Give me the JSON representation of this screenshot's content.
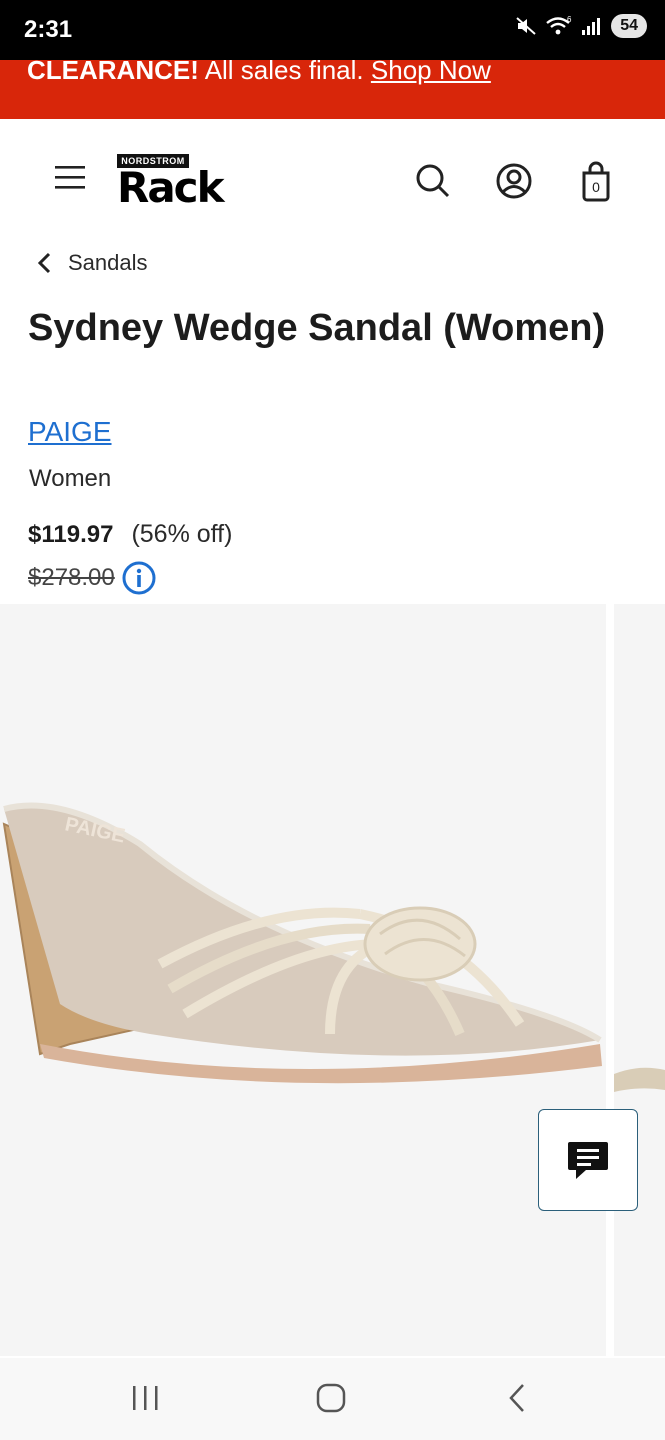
{
  "status": {
    "time": "2:31",
    "battery": "54",
    "network": "6"
  },
  "promo": {
    "strong": "CLEARANCE!",
    "text": "All sales final.",
    "link": "Shop Now",
    "bg_color": "#d8260a"
  },
  "header": {
    "logo_top": "NORDSTROM",
    "logo_main": "Rack",
    "icons": [
      "menu-icon",
      "search-icon",
      "account-icon",
      "bag-icon"
    ]
  },
  "breadcrumb": {
    "label": "Sandals"
  },
  "product": {
    "title": "Sydney Wedge Sandal (Women)",
    "brand": "PAIGE",
    "department": "Women",
    "sale_price": "$119.97",
    "discount": "(56% off)",
    "original_price": "$278.00",
    "brand_color": "#1e6fd0"
  },
  "gallery": {
    "image_subject": "cream knotted-strap cork wedge sandal",
    "insole_text": "PAIGE"
  },
  "chat": {
    "icon": "chat-icon"
  },
  "navbar": {
    "icons": [
      "recent-apps-icon",
      "home-icon",
      "back-icon"
    ]
  }
}
